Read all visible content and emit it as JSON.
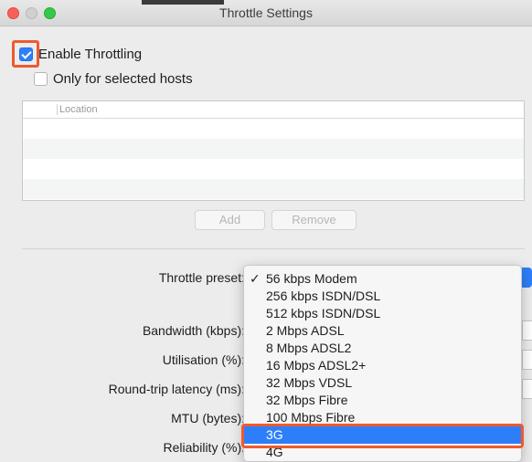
{
  "window": {
    "title": "Throttle Settings"
  },
  "throttling": {
    "enable_label": "Enable Throttling",
    "enable_checked": true,
    "selected_hosts_label": "Only for selected hosts",
    "selected_hosts_checked": false
  },
  "hosts_table": {
    "column_header": "Location",
    "rows": [
      "",
      "",
      "",
      ""
    ]
  },
  "buttons": {
    "add_label": "Add",
    "remove_label": "Remove"
  },
  "fields": {
    "preset_label": "Throttle preset:",
    "bandwidth_label": "Bandwidth (kbps):",
    "utilisation_label": "Utilisation (%):",
    "latency_label": "Round-trip latency (ms):",
    "mtu_label": "MTU (bytes):",
    "reliability_label": "Reliability (%):"
  },
  "preset_menu": {
    "checkmark": "✓",
    "selected_value": "56 kbps Modem",
    "highlighted_value": "3G",
    "items": [
      "56 kbps Modem",
      "256 kbps ISDN/DSL",
      "512 kbps ISDN/DSL",
      "2 Mbps ADSL",
      "8 Mbps ADSL2",
      "16 Mbps ADSL2+",
      "32 Mbps VDSL",
      "32 Mbps Fibre",
      "100 Mbps Fibre",
      "3G",
      "4G"
    ]
  },
  "colors": {
    "accent": "#2d7ff9",
    "annotation": "#ee5a2e"
  }
}
